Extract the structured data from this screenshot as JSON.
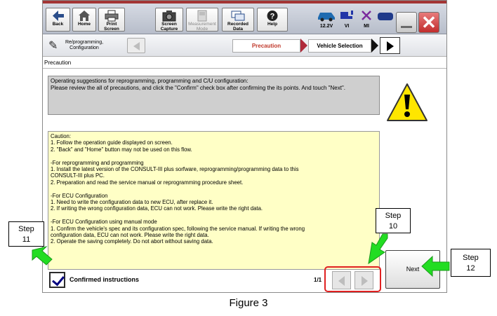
{
  "toolbar": {
    "buttons": [
      {
        "label": "Back"
      },
      {
        "label": "Home"
      },
      {
        "label": "Print Screen"
      },
      {
        "label": "Screen Capture"
      },
      {
        "label": "Measurement Mode"
      },
      {
        "label": "Recorded Data"
      },
      {
        "label": "Help"
      }
    ],
    "status": [
      {
        "label": "12.2V"
      },
      {
        "label": "VI"
      },
      {
        "label": "MI"
      }
    ]
  },
  "nav": {
    "mode_label": "Re/programming, Configuration",
    "steps": [
      {
        "label": "Precaution",
        "active": true
      },
      {
        "label": "Vehicle Selection",
        "active": false
      }
    ]
  },
  "screen": {
    "title": "Precaution",
    "operating_intro": "Operating suggestions for reprogramming, programming and C/U configuration:",
    "operating_text": "Please review the all of precautions, and click the \"Confirm\" check box after confirming the its points. And touch \"Next\".",
    "caution_lines": [
      "Caution:",
      "1. Follow the operation guide displayed on screen.",
      "2. \"Back\" and  \"Home\" button may not be used on this flow.",
      "",
      "-For reprogramming and programming",
      "1. Install the latest version of the CONSULT-III plus sorfware, reprogramming/programming data to this",
      "CONSULT-III plus PC.",
      "2. Preparation and read the service manual or reprogramming procedure sheet.",
      "",
      "-For ECU Configuration",
      "1. Need to write the configuration data to new ECU, after replace it.",
      "2. If writing the wrong configuration data, ECU can not work. Please write the right data.",
      "",
      "-For ECU Configuration using manual mode",
      "1. Confirm the vehicle's spec and its configuration spec, following the service manual.  If writing the wrong",
      "configuration data, ECU can not work. Please write the right data.",
      "2. Operate the saving completely. Do not abort without saving data."
    ],
    "confirm_label": "Confirmed instructions",
    "confirm_checked": true,
    "page_indicator": "1/1",
    "next_label": "Next"
  },
  "callouts": {
    "step10": "Step 10",
    "step11": "Step 11",
    "step12": "Step 12"
  },
  "figure_caption": "Figure 3",
  "colors": {
    "caution_bg": "#ffffc6",
    "ops_bg": "#cfcfcf",
    "active_step_text": "#c0392b",
    "callout_arrow": "#22dd22",
    "highlight_border": "#e02020"
  }
}
